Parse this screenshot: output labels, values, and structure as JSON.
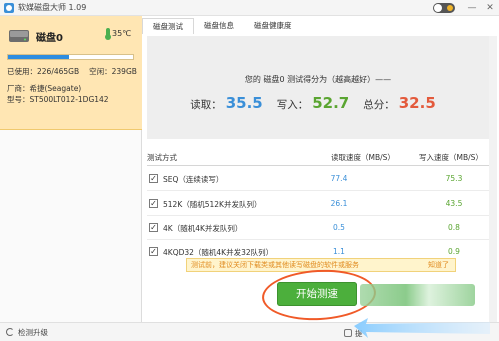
{
  "app": {
    "title": "软媒磁盘大师 1.09"
  },
  "window": {
    "minimize": "—",
    "close": "✕"
  },
  "disk": {
    "name": "磁盘0",
    "temperature": "35℃",
    "used": "已使用：226/465GB",
    "free": "空闲：239GB",
    "usage_fraction": 0.486,
    "vendor": "厂商：希捷(Seagate)",
    "model": "型号：ST500LT012-1DG142"
  },
  "footer": {
    "check_upgrade": "检测升级",
    "right_label": "提"
  },
  "tabs": [
    {
      "label": "磁盘测试"
    },
    {
      "label": "磁盘信息"
    },
    {
      "label": "磁盘健康度"
    }
  ],
  "result": {
    "desc": "您的 磁盘0 测试得分为（越高越好）——",
    "read_label": "读取：",
    "read_value": "35.5",
    "write_label": "写入：",
    "write_value": "52.7",
    "total_label": "总分：",
    "total_value": "32.5"
  },
  "table": {
    "headers": {
      "mode": "测试方式",
      "read": "读取速度（MB/S）",
      "write": "写入速度（MB/S）"
    },
    "rows": [
      {
        "name": "SEQ（连续读写）",
        "read": "77.4",
        "write": "75.3",
        "checked": "✓"
      },
      {
        "name": "512K（随机512K并发队列）",
        "read": "26.1",
        "write": "43.5",
        "checked": "✓"
      },
      {
        "name": "4K（随机4K并发队列）",
        "read": "0.5",
        "write": "0.8",
        "checked": "✓"
      },
      {
        "name": "4KQD32（随机4K并发32队列）",
        "read": "1.1",
        "write": "0.9",
        "checked": "✓"
      }
    ]
  },
  "warning": {
    "text": "测试前，建议关闭下载类或其他读写磁盘的软件或服务",
    "link": "知道了"
  },
  "start_button": {
    "label": "开始测速"
  },
  "colors": {
    "read": "#3a8fd8",
    "write": "#5aa531",
    "total": "#e35a3c",
    "button": "#4caf3c",
    "disk_card": "#ffe6b3"
  }
}
